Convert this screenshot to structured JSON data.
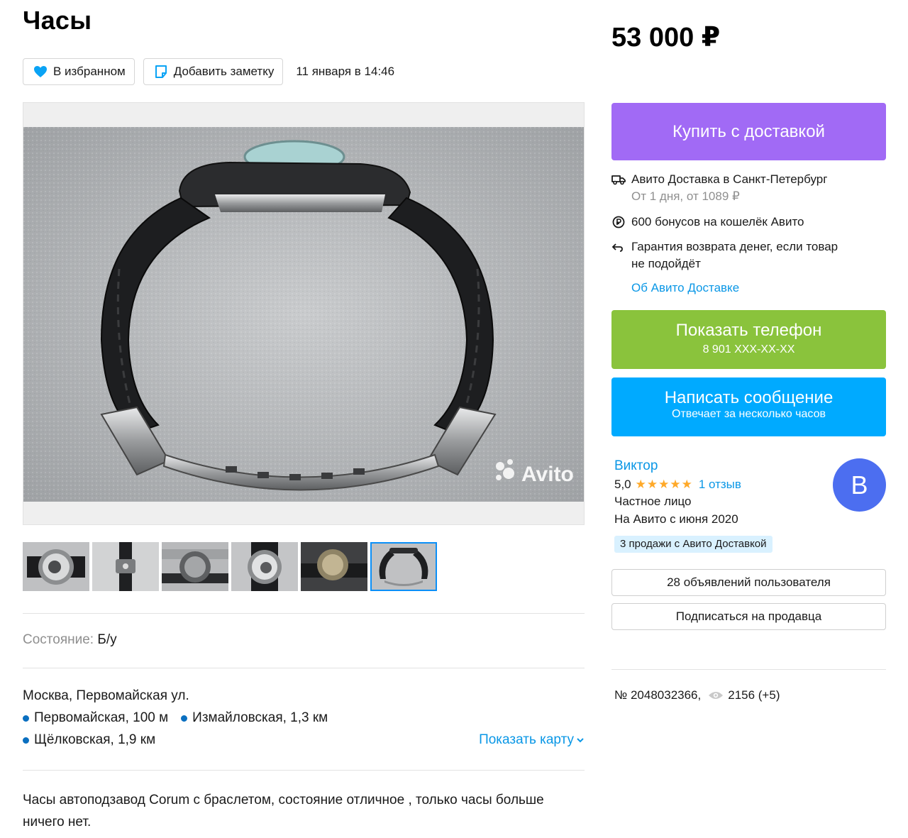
{
  "listing": {
    "title": "Часы",
    "favorite_label": "В избранном",
    "note_label": "Добавить заметку",
    "date": "11 января в 14:46",
    "watermark": "Avito",
    "condition_key": "Состояние:",
    "condition_value": "Б/у",
    "address": "Москва, Первомайская ул.",
    "metro": [
      {
        "name": "Первомайская, 100 м",
        "color": "#0a6fc0"
      },
      {
        "name": "Измайловская, 1,3 км",
        "color": "#0a6fc0"
      },
      {
        "name": "Щёлковская, 1,9 км",
        "color": "#0a6fc0"
      }
    ],
    "show_map_label": "Показать карту",
    "description": "Часы автоподзавод Corum с браслетом, состояние отличное , только часы больше ничего нет.",
    "thumbnails_count": 6,
    "active_thumbnail": 6
  },
  "sidebar": {
    "price": "53 000 ₽",
    "buy_label": "Купить с доставкой",
    "delivery_title": "Авито Доставка в Санкт-Петербург",
    "delivery_sub": "От 1 дня, от 1089 ₽",
    "bonus": "600 бонусов на кошелёк Авито",
    "guarantee_line1": "Гарантия возврата денег, если товар",
    "guarantee_line2": "не подойдёт",
    "about_delivery": "Об Авито Доставке",
    "phone_label": "Показать телефон",
    "phone_number": "8 901 XXX-XX-XX",
    "message_label": "Написать сообщение",
    "message_sub": "Отвечает за несколько часов",
    "seller": {
      "name": "Виктор",
      "rating": "5,0",
      "stars": "★★★★★",
      "reviews": "1 отзыв",
      "type": "Частное лицо",
      "since": "На Авито с июня 2020",
      "badge": "3 продажи с Авито Доставкой",
      "avatar_letter": "В"
    },
    "user_ads": "28 объявлений пользователя",
    "subscribe": "Подписаться на продавца",
    "ad_number": "№ 2048032366,",
    "views": "2156 (+5)"
  },
  "colors": {
    "buy": "#a16af5",
    "phone": "#8ac33c",
    "message": "#00aaff",
    "link": "#0a97e6",
    "avatar": "#4c6ef0",
    "stars": "#ffa928"
  }
}
